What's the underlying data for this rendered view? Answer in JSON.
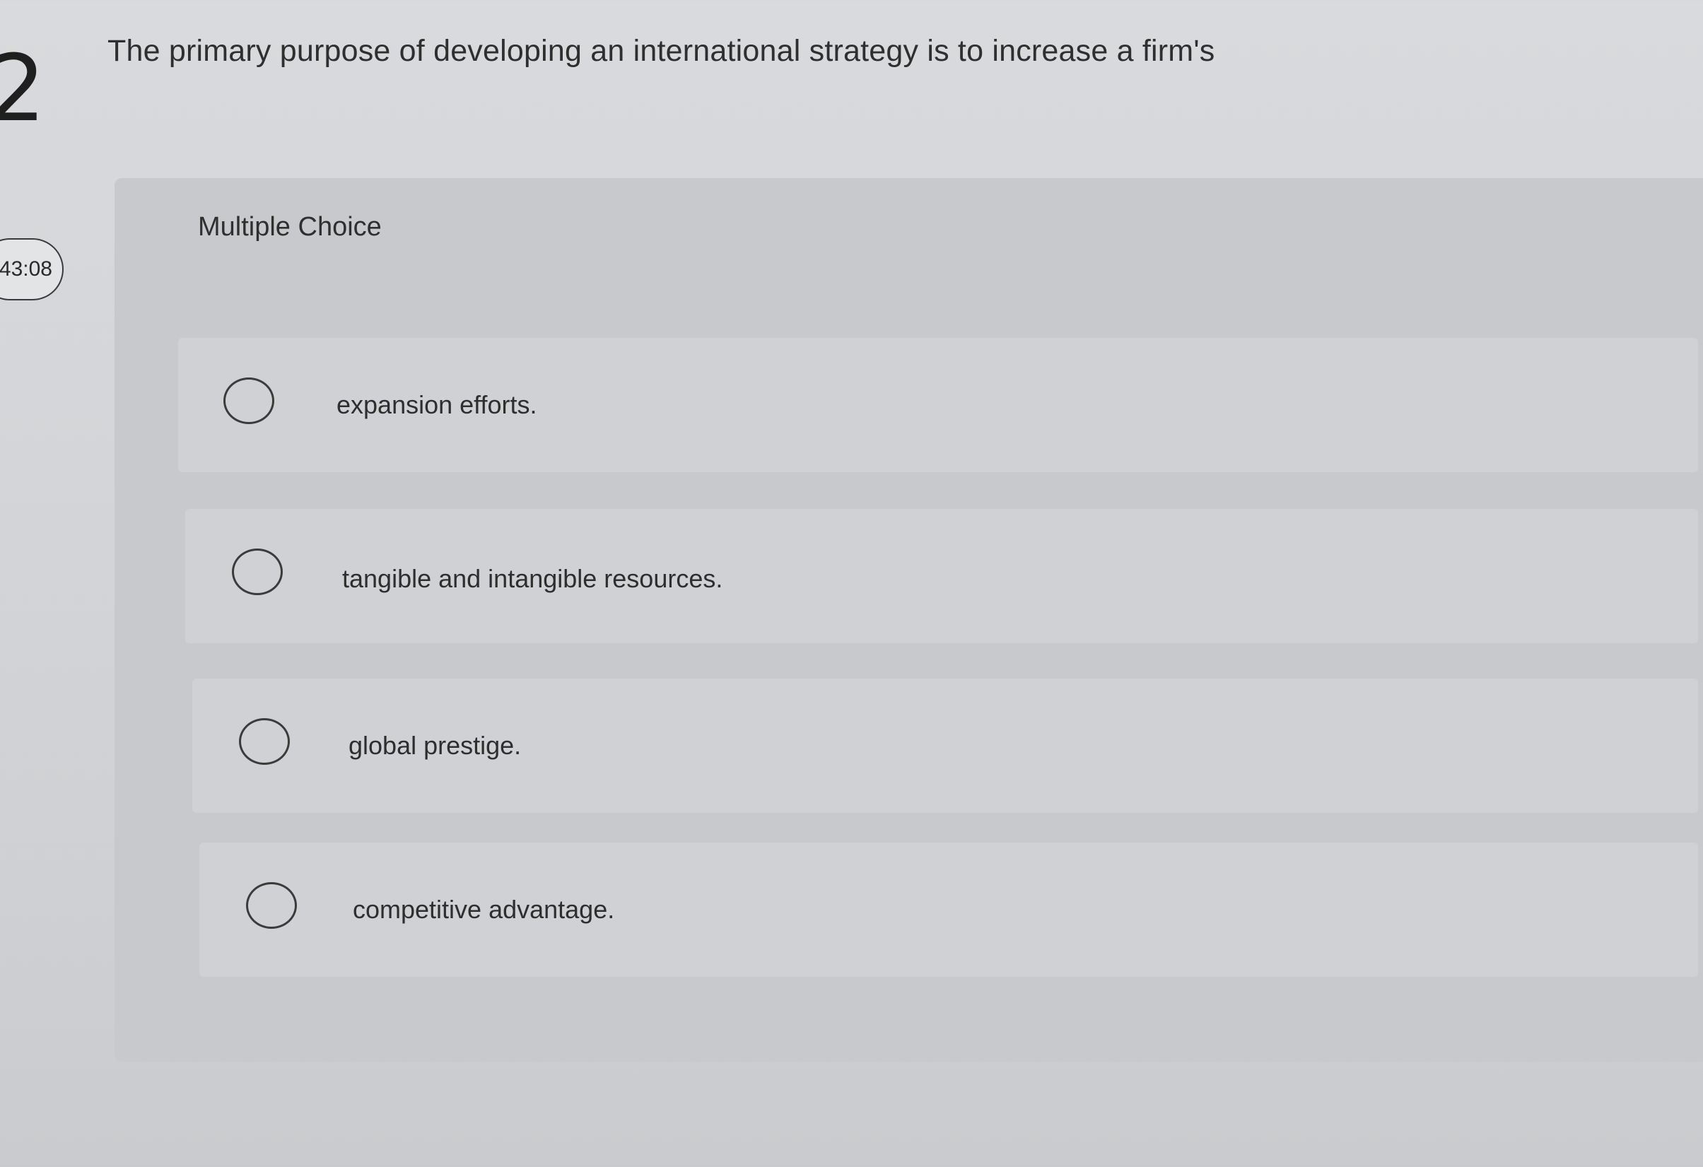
{
  "quiz": {
    "question_number": "2",
    "timer": "43:08",
    "question_text": "The primary purpose of developing an international strategy is to increase a firm's",
    "question_type": "Multiple Choice",
    "choices": [
      {
        "label": "expansion efforts."
      },
      {
        "label": "tangible and intangible resources."
      },
      {
        "label": "global prestige."
      },
      {
        "label": "competitive advantage."
      }
    ]
  },
  "colors": {
    "background": "#d6d8db",
    "card": "#c7c9cc",
    "text": "#2e2e2e",
    "radio_border": "#3b3b3b"
  }
}
